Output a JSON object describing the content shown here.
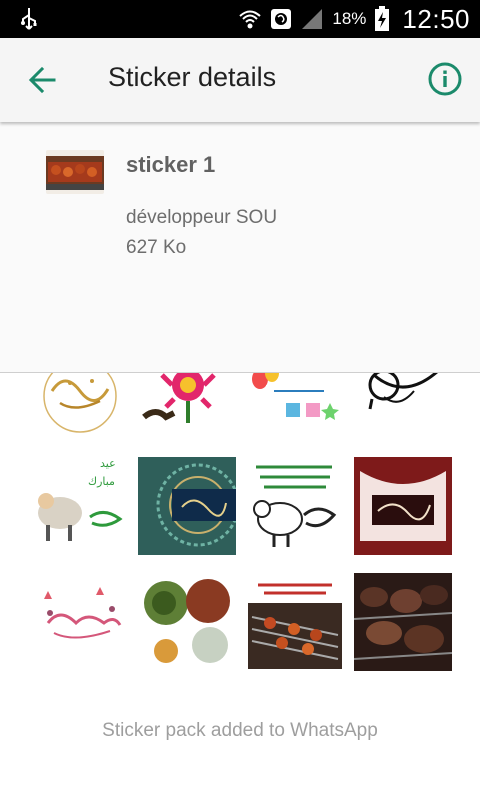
{
  "status_bar": {
    "battery_percent": "18%",
    "time": "12:50"
  },
  "app_bar": {
    "title": "Sticker details"
  },
  "pack": {
    "name": "sticker 1",
    "publisher": "développeur SOU",
    "size": "627 Ko"
  },
  "stickers": [
    {
      "icon": "eid-calligraphy-gold"
    },
    {
      "icon": "flower-mubarak"
    },
    {
      "icon": "balloons-greeting"
    },
    {
      "icon": "black-calligraphy"
    },
    {
      "icon": "sheep-eid-mubarak"
    },
    {
      "icon": "blue-ornament-card"
    },
    {
      "icon": "sheep-text-card"
    },
    {
      "icon": "eid-frame-red"
    },
    {
      "icon": "lantern-eid-text"
    },
    {
      "icon": "food-platters"
    },
    {
      "icon": "grill-skewers-text"
    },
    {
      "icon": "grilled-meat"
    }
  ],
  "footer": {
    "status": "Sticker pack added to WhatsApp"
  },
  "colors": {
    "accent": "#1b8a6b",
    "title": "#212121",
    "muted": "#9e9e9e"
  }
}
